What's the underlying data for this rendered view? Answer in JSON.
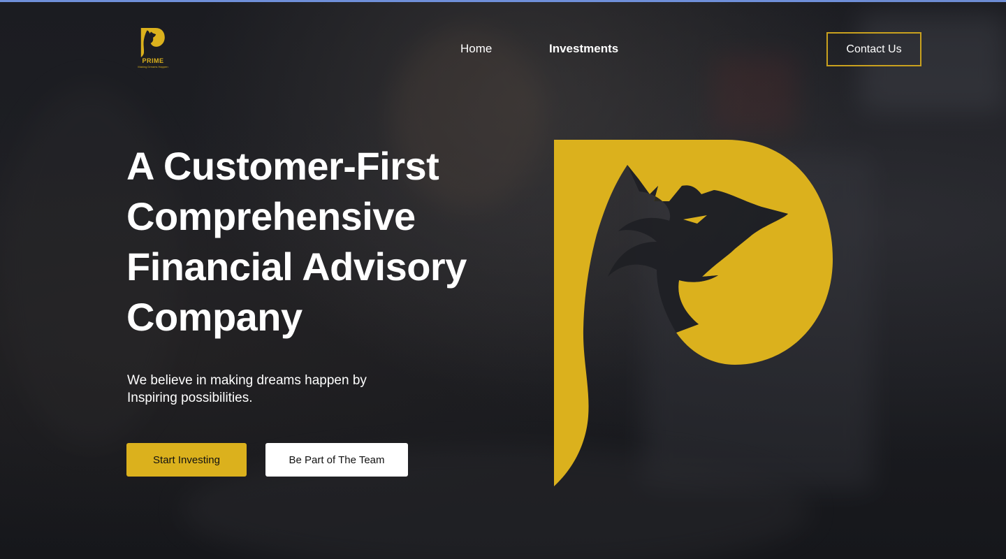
{
  "brand": {
    "name": "PRIME",
    "tagline": "Making Dreams Happen",
    "accent_color": "#dbb11d"
  },
  "nav": {
    "items": [
      {
        "label": "Home"
      },
      {
        "label": "Investments"
      }
    ],
    "contact_label": "Contact Us"
  },
  "hero": {
    "title_lines": [
      "A Customer-First",
      "Comprehensive",
      "Financial Advisory",
      "Company"
    ],
    "subtitle_lines": [
      "We believe in making dreams happen by",
      "Inspiring possibilities."
    ],
    "primary_button": "Start Investing",
    "secondary_button": "Be Part of The Team"
  },
  "icons": {
    "logo": "prime-wolf-p-logo",
    "hero_graphic": "prime-wolf-p-logo"
  }
}
